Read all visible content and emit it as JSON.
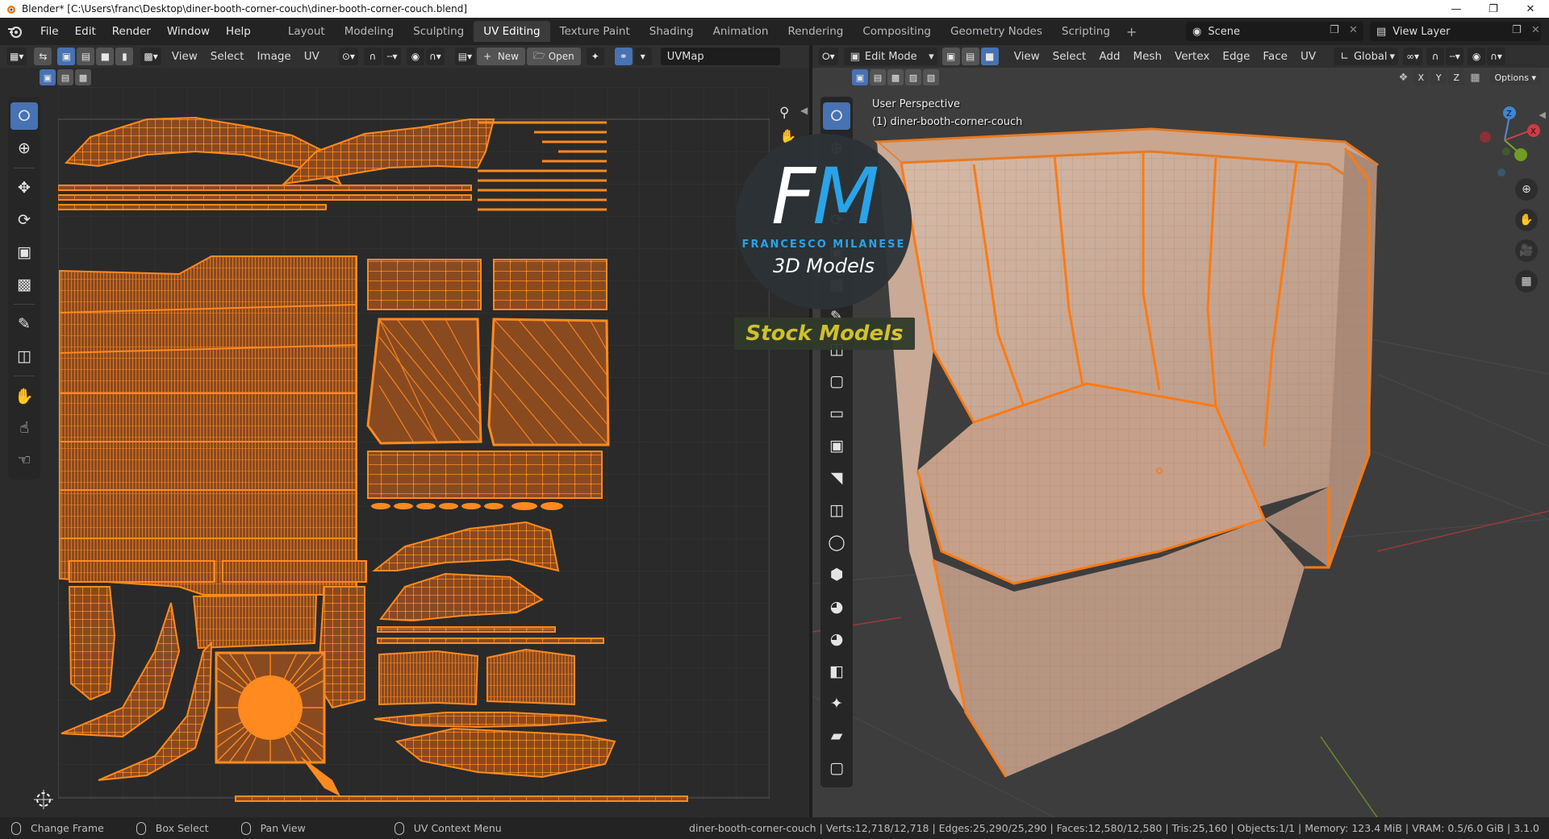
{
  "window": {
    "title": "Blender* [C:\\Users\\franc\\Desktop\\diner-booth-corner-couch\\diner-booth-corner-couch.blend]",
    "min_icon": "minimize-icon",
    "max_icon": "maximize-icon",
    "close_icon": "close-icon"
  },
  "menu": [
    "File",
    "Edit",
    "Render",
    "Window",
    "Help"
  ],
  "workspaces": [
    "Layout",
    "Modeling",
    "Sculpting",
    "UV Editing",
    "Texture Paint",
    "Shading",
    "Animation",
    "Rendering",
    "Compositing",
    "Geometry Nodes",
    "Scripting"
  ],
  "active_workspace": "UV Editing",
  "scene": "Scene",
  "view_layer": "View Layer",
  "uv_editor": {
    "menus": [
      "View",
      "Select",
      "Image",
      "UV"
    ],
    "new_label": "New",
    "open_label": "Open",
    "uv_map": "UVMap"
  },
  "viewport": {
    "mode": "Edit Mode",
    "menus": [
      "View",
      "Select",
      "Add",
      "Mesh",
      "Vertex",
      "Edge",
      "Face",
      "UV"
    ],
    "transform_orientation": "Global",
    "options_label": "Options",
    "view_name": "User Perspective",
    "object_name": "(1) diner-booth-corner-couch",
    "axes": [
      "X",
      "Y",
      "Z"
    ]
  },
  "watermark": {
    "f": "F",
    "m": "M",
    "name": "FRANCESCO MILANESE",
    "sub": "3D Models",
    "stock": "Stock Models"
  },
  "status": {
    "left": [
      {
        "label": "Change Frame"
      },
      {
        "label": "Box Select"
      },
      {
        "label": "Pan View"
      },
      {
        "label": "UV Context Menu"
      }
    ],
    "stats": "diner-booth-corner-couch | Verts:12,718/12,718 | Edges:25,290/25,290 | Faces:12,580/12,580 | Tris:25,160 | Objects:1/1 | Memory: 123.4 MiB | VRAM: 0.5/6.0 GiB | 3.1.0"
  },
  "colors": {
    "accent": "#4772b3",
    "uv_orange": "#ff8a1f",
    "uv_fill": "#8a4a20",
    "couch": "#c9a892"
  }
}
